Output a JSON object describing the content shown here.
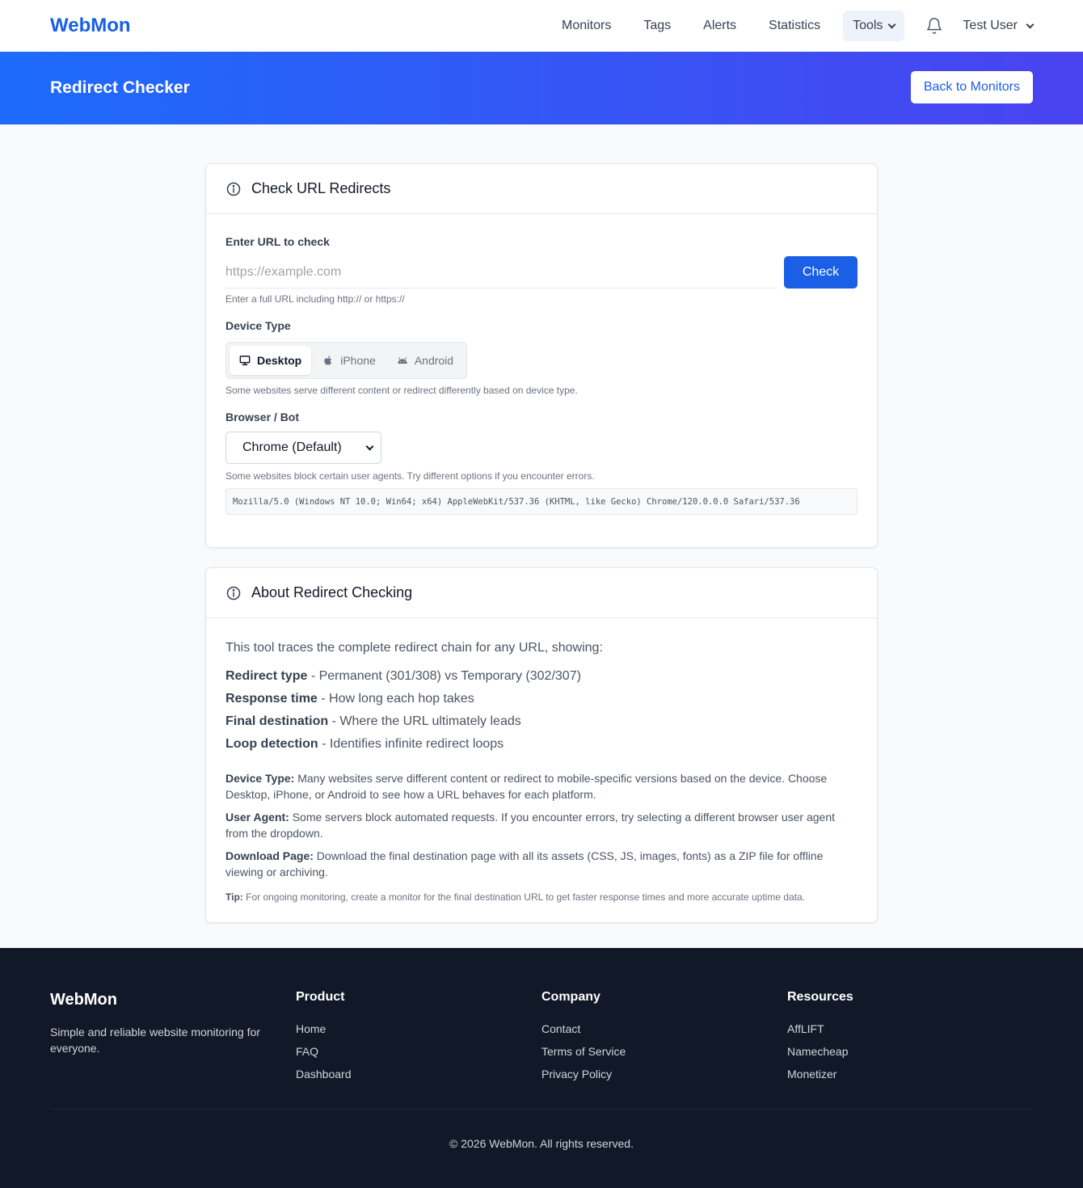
{
  "nav": {
    "brand": "WebMon",
    "links": [
      "Monitors",
      "Tags",
      "Alerts",
      "Statistics"
    ],
    "tools_label": "Tools",
    "user_name": "Test User"
  },
  "hero": {
    "title": "Redirect Checker",
    "back_button": "Back to Monitors"
  },
  "checker": {
    "title": "Check URL Redirects",
    "url_label": "Enter URL to check",
    "url_placeholder": "https://example.com",
    "url_value": "",
    "check_button": "Check",
    "url_help": "Enter a full URL including http:// or https://",
    "device_label": "Device Type",
    "devices": [
      "Desktop",
      "iPhone",
      "Android"
    ],
    "device_selected": "Desktop",
    "device_help": "Some websites serve different content or redirect differently based on device type.",
    "browser_label": "Browser / Bot",
    "browser_selected": "Chrome (Default)",
    "browser_help": "Some websites block certain user agents. Try different options if you encounter errors.",
    "user_agent": "Mozilla/5.0 (Windows NT 10.0; Win64; x64) AppleWebKit/537.36 (KHTML, like Gecko) Chrome/120.0.0.0 Safari/537.36"
  },
  "about": {
    "title": "About Redirect Checking",
    "intro": "This tool traces the complete redirect chain for any URL, showing:",
    "features": [
      {
        "term": "Redirect type",
        "desc": " - Permanent (301/308) vs Temporary (302/307)"
      },
      {
        "term": "Response time",
        "desc": " - How long each hop takes"
      },
      {
        "term": "Final destination",
        "desc": " - Where the URL ultimately leads"
      },
      {
        "term": "Loop detection",
        "desc": " - Identifies infinite redirect loops"
      }
    ],
    "notes": [
      {
        "term": "Device Type:",
        "desc": " Many websites serve different content or redirect to mobile-specific versions based on the device. Choose Desktop, iPhone, or Android to see how a URL behaves for each platform."
      },
      {
        "term": "User Agent:",
        "desc": " Some servers block automated requests. If you encounter errors, try selecting a different browser user agent from the dropdown."
      },
      {
        "term": "Download Page:",
        "desc": " Download the final destination page with all its assets (CSS, JS, images, fonts) as a ZIP file for offline viewing or archiving."
      }
    ],
    "tip_term": "Tip:",
    "tip_desc": " For ongoing monitoring, create a monitor for the final destination URL to get faster response times and more accurate uptime data."
  },
  "footer": {
    "brand": "WebMon",
    "tagline": "Simple and reliable website monitoring for everyone.",
    "columns": [
      {
        "heading": "Product",
        "links": [
          "Home",
          "FAQ",
          "Dashboard"
        ]
      },
      {
        "heading": "Company",
        "links": [
          "Contact",
          "Terms of Service",
          "Privacy Policy"
        ]
      },
      {
        "heading": "Resources",
        "links": [
          "AffLIFT",
          "Namecheap",
          "Monetizer"
        ]
      }
    ],
    "copyright": "© 2026 WebMon. All rights reserved."
  },
  "colors": {
    "brand": "#1a5fe6",
    "hero_start": "#1d6bfb",
    "hero_end": "#4a43f0",
    "footer_bg": "#111827"
  }
}
